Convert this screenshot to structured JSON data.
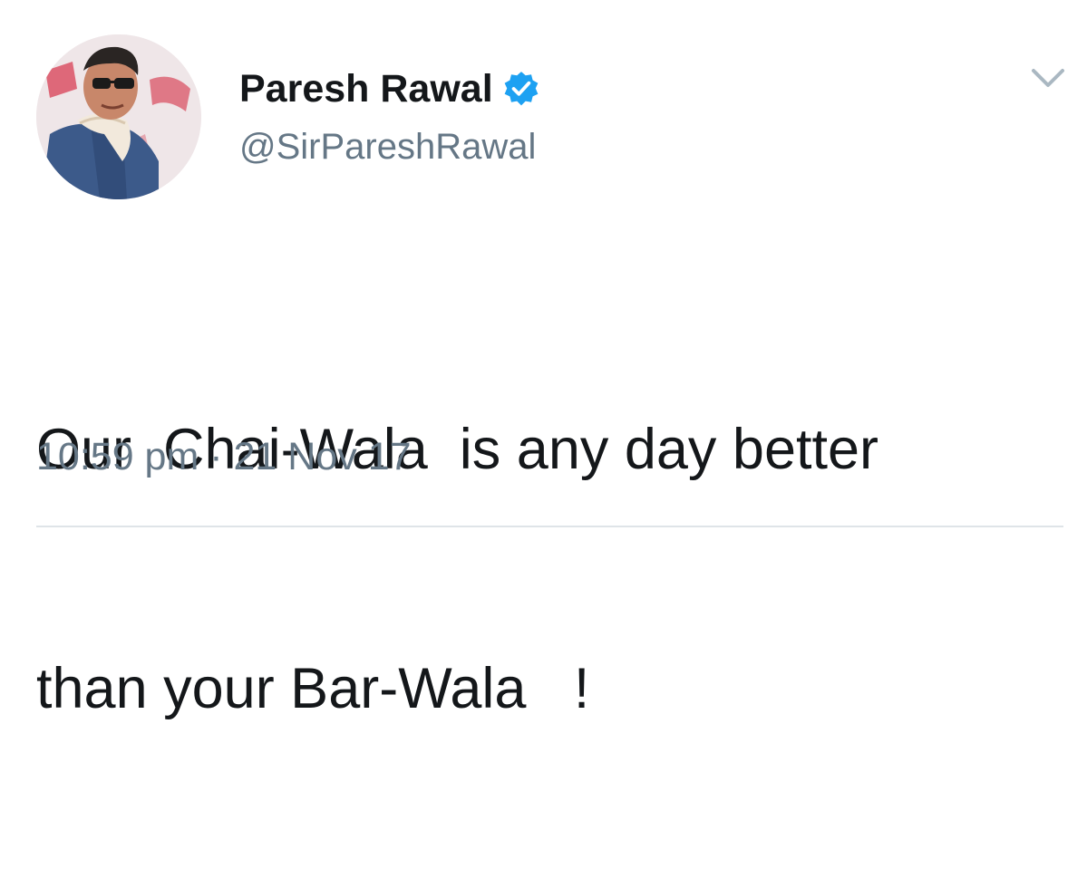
{
  "tweet": {
    "author": {
      "display_name": "Paresh Rawal",
      "handle": "@SirPareshRawal",
      "verified": true,
      "avatar_icon": "profile-photo"
    },
    "text_lines": [
      "Our  Chai-Wala  is any day better",
      "than your Bar-Wala   !"
    ],
    "timestamp": "10:59 pm · 21 Nov 17",
    "menu_icon": "chevron-down-icon"
  },
  "colors": {
    "verified_blue": "#1da1f2",
    "secondary_text": "#657786",
    "primary_text": "#14171a",
    "divider": "#dfe4e8"
  }
}
